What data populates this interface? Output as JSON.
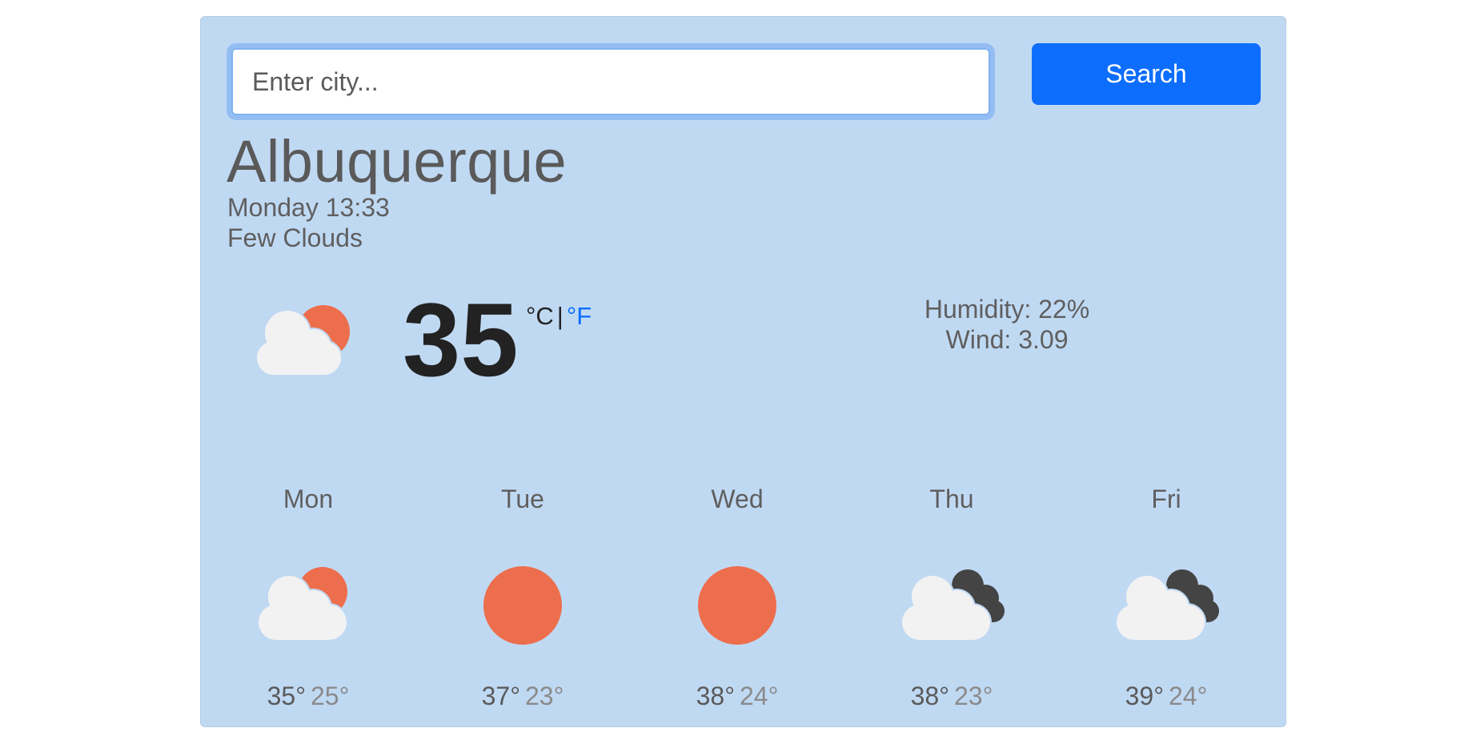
{
  "search": {
    "placeholder": "Enter city...",
    "button_label": "Search"
  },
  "current": {
    "city": "Albuquerque",
    "datetime": "Monday 13:33",
    "condition": "Few Clouds",
    "temperature": "35",
    "unit_c": "°C",
    "unit_separator": "|",
    "unit_f": "°F",
    "icon": "few-clouds-day-icon",
    "humidity": "Humidity: 22%",
    "wind": "Wind: 3.09"
  },
  "forecast": [
    {
      "day": "Mon",
      "high": "35°",
      "low": "25°",
      "icon": "few-clouds-day-icon"
    },
    {
      "day": "Tue",
      "high": "37°",
      "low": "23°",
      "icon": "clear-sky-icon"
    },
    {
      "day": "Wed",
      "high": "38°",
      "low": "24°",
      "icon": "clear-sky-icon"
    },
    {
      "day": "Thu",
      "high": "38°",
      "low": "23°",
      "icon": "broken-clouds-icon"
    },
    {
      "day": "Fri",
      "high": "39°",
      "low": "24°",
      "icon": "broken-clouds-icon"
    }
  ],
  "colors": {
    "card_background": "#c0d9f3",
    "primary": "#0d6efd",
    "sun": "#ed6e4d",
    "cloud_light": "#f2f2f2",
    "cloud_dark": "#444444"
  }
}
